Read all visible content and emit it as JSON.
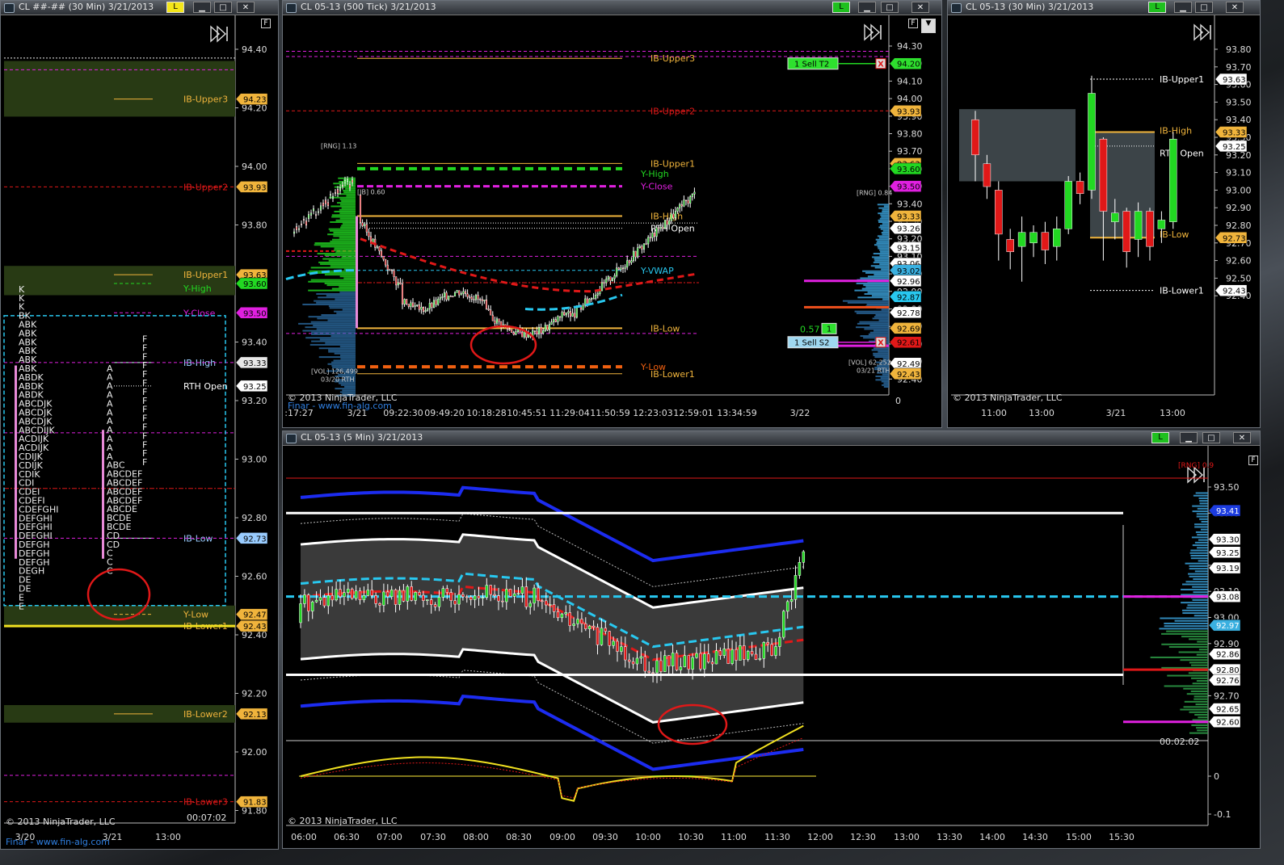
{
  "colors": {
    "gold": "#f0b43c",
    "red": "#e01818",
    "green": "#22d822",
    "magenta": "#e020e0",
    "cyan": "#28c8f0",
    "blue": "#1c2cf0",
    "yellow": "#f0e020",
    "olive": "#283a14"
  },
  "icons": {
    "ff_icon": "fast-forward-icon",
    "minimize": "minimize-icon",
    "maximize": "maximize-icon",
    "close": "close-icon"
  },
  "window1": {
    "title": "CL ##-## (30 Min)  3/21/2013",
    "link_label": "L",
    "fbox": "F",
    "axis_ticks": [
      "94.40",
      "94.20",
      "94.00",
      "93.80",
      "93.60",
      "93.40",
      "93.20",
      "93.00",
      "92.80",
      "92.60",
      "92.40",
      "92.20",
      "92.00",
      "91.80"
    ],
    "level_labels": [
      "IB-Upper3",
      "IB-Upper2",
      "IB-Upper1",
      "Y-High",
      "Y-Close",
      "IB-High",
      "RTH Open",
      "IB-Low",
      "Y-Low",
      "IB-Lower1",
      "IB-Lower2",
      "IB-Lower3"
    ],
    "price_flags": [
      "94.23",
      "93.93",
      "93.63",
      "93.60",
      "93.50",
      "93.33",
      "93.25",
      "92.73",
      "92.47",
      "92.43",
      "92.13",
      "91.83"
    ],
    "tpo_rows": [
      "K",
      "K",
      "K",
      "BK",
      "ABK",
      "ABK",
      "ABK",
      "ABK",
      "ABK",
      "ABK",
      "ABDK",
      "ABDK",
      "ABDK",
      "ABCDJK",
      "ABCDJK",
      "ABCDJK",
      "ABCDIJK",
      "ACDIJK",
      "ACDIJK",
      "CDIJK",
      "CDIJK",
      "CDIK",
      "CDI",
      "CDEI",
      "CDEFI",
      "CDEFGHI",
      "DEFGHI",
      "DEFGHI",
      "DEFGHI",
      "DEFGH",
      "DEFGH",
      "DEFGH",
      "DEGH",
      "DE",
      "DE",
      "E",
      "E"
    ],
    "tpo_rows2": [
      "A",
      "A",
      "A",
      "A",
      "A",
      "A",
      "A",
      "A",
      "A",
      "A",
      "A",
      "ABC",
      "ABCDEF",
      "ABCDEF",
      "ABCDEF",
      "ABCDEF",
      "ABCDE",
      "BCDE",
      "BCDE",
      "CD",
      "CD",
      "C",
      "C",
      "C"
    ],
    "tpo_rows3": [
      "F",
      "F",
      "F",
      "F",
      "F",
      "F",
      "F",
      "F",
      "F",
      "F",
      "F",
      "F",
      "F",
      "F",
      "F"
    ],
    "x_ticks": [
      "3/20",
      "3/21",
      "13:00"
    ],
    "timer": "00:07:02",
    "copyright": "© 2013 NinjaTrader, LLC",
    "finalink": "Finar - www.fin-alg.com"
  },
  "window2": {
    "title": "CL 05-13 (500 Tick)  3/21/2013",
    "link_label": "L",
    "fbox": "F",
    "axis_ticks": [
      "94.30",
      "94.20",
      "94.10",
      "94.00",
      "93.90",
      "93.80",
      "93.70",
      "93.60",
      "93.50",
      "93.40",
      "93.30",
      "93.20",
      "93.10",
      "93.00",
      "92.90",
      "92.80",
      "92.70",
      "92.60",
      "92.50",
      "92.40",
      "0"
    ],
    "level_labels": [
      "IB-Upper3",
      "IB-Upper2",
      "IB-Upper1",
      "Y-High",
      "Y-Close",
      "IB-High",
      "RTH Open",
      "Y-VWAP",
      "IB-Low",
      "Y-Low",
      "IB-Lower1"
    ],
    "price_flags": [
      "94.20",
      "93.93",
      "93.63",
      "93.60",
      "93.50",
      "93.33",
      "93.26",
      "93.15",
      "93.06",
      "93.02",
      "92.96",
      "92.87",
      "92.78",
      "92.69",
      "92.61",
      "92.49",
      "92.43"
    ],
    "orders": {
      "sell_t2": "1  Sell T2",
      "sell_s2": "1  Sell S2",
      "pnl": "0.57",
      "qty": "1",
      "cancel": "X"
    },
    "small_labels": {
      "rng_left": "[RNG] 1.13",
      "ib_left": "[IB] 0.60",
      "rng_right": "[RNG] 0.84",
      "vol_left": "[VOL] 126,499",
      "vol_left_date": "03/20 RTH",
      "vol_right": "[VOL] 62,252",
      "vol_right_date": "03/21 RTH"
    },
    "x_ticks": [
      ":17:27",
      "3/21",
      "09:22:30",
      "09:49:20",
      "10:18:28",
      "10:45:51",
      "11:29:04",
      "11:50:59",
      "12:23:03",
      "12:59:01",
      "13:34:59",
      "3/22"
    ],
    "copyright": "© 2013 NinjaTrader, LLC",
    "finalink": "Finar - www.fin-alg.com"
  },
  "window3": {
    "title": "CL 05-13 (30 Min)  3/21/2013",
    "link_label": "L",
    "axis_ticks": [
      "93.80",
      "93.70",
      "93.60",
      "93.50",
      "93.40",
      "93.30",
      "93.20",
      "93.10",
      "93.00",
      "92.90",
      "92.80",
      "92.70",
      "92.60",
      "92.50",
      "92.40"
    ],
    "level_labels": [
      "IB-Upper1",
      "IB-High",
      "RTH Open",
      "IB-Low",
      "IB-Lower1"
    ],
    "price_flags": [
      "93.63",
      "93.33",
      "93.25",
      "92.73",
      "92.43"
    ],
    "x_ticks": [
      "11:00",
      "13:00",
      "3/21",
      "13:00"
    ],
    "copyright": "© 2013 NinjaTrader, LLC"
  },
  "window4": {
    "title": "CL 05-13 (5 Min)  3/21/2013",
    "link_label": "L",
    "fbox": "F",
    "axis_ticks": [
      "93.50",
      "93.40",
      "93.30",
      "93.20",
      "93.10",
      "93.00",
      "92.90",
      "92.80",
      "92.70",
      "92.60",
      "0",
      "-0.1"
    ],
    "price_flags": [
      "93.41",
      "93.30",
      "93.25",
      "93.19",
      "93.08",
      "92.97",
      "92.86",
      "92.80",
      "92.76",
      "92.65",
      "92.60"
    ],
    "rng_label": "[RNG] 0.9",
    "timer": "00:02:02",
    "x_ticks": [
      "06:00",
      "06:30",
      "07:00",
      "07:30",
      "08:00",
      "08:30",
      "09:00",
      "09:30",
      "10:00",
      "10:30",
      "11:00",
      "11:30",
      "12:00",
      "12:30",
      "13:00",
      "13:30",
      "14:00",
      "14:30",
      "15:00",
      "15:30"
    ],
    "copyright": "© 2013 NinjaTrader, LLC"
  }
}
